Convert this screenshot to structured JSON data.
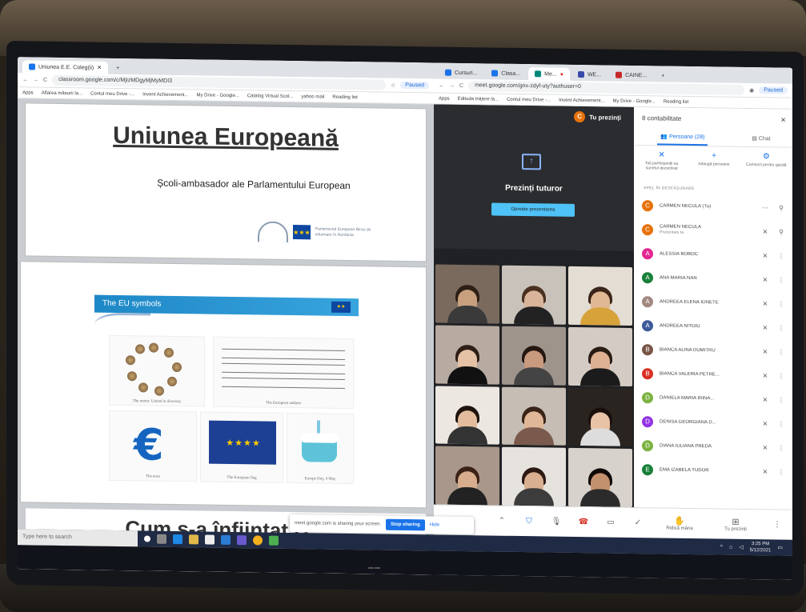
{
  "left_browser": {
    "tab_title": "Uniunea E.E. Coleg(ii)",
    "url": "classroom.google.com/c/MjIzMDgyMjMyMDI3",
    "profile": "Paused",
    "bookmarks": [
      "Apps",
      "Aflarea măsurii la...",
      "Contul meu Drive -...",
      "Invent Achievement...",
      "My Drive - Google...",
      "Catalog Virtual Scol...",
      "yahoo mail",
      "Reading list"
    ]
  },
  "slides": {
    "slide1_title": "Uniunea Europeană",
    "slide1_subtitle": "Școli-ambasador ale Parlamentului European",
    "ep_logo_text": "Parlamentul European Birou de informare în România",
    "slide2_banner": "The EU symbols",
    "captions": {
      "motto": "The motto: United in diversity",
      "anthem": "The European anthem",
      "euro": "The euro",
      "flag": "The European flag",
      "europe_day": "Europe Day, 9 May"
    },
    "slide3_title": "Cum s-a înființat U..."
  },
  "share_bar": {
    "message": "meet.google.com is sharing your screen.",
    "stop": "Stop sharing",
    "hide": "Hide"
  },
  "taskbar": {
    "search_placeholder": "Type here to search",
    "time": "3:25 PM",
    "date": "5/12/2021"
  },
  "right_browser": {
    "tabs": [
      "Cursuri...",
      "Clasa...",
      "Me...",
      "WE...",
      "CAINE..."
    ],
    "url": "meet.google.com/gnx-zdyf-uty?authuser=0",
    "profile": "Paused",
    "bookmarks": [
      "Apps",
      "Edituda Inițiere la...",
      "Contul meu Drive -...",
      "Invent Achievement...",
      "My Drive - Google...",
      "Reading list"
    ]
  },
  "meet": {
    "presenter_label": "Tu prezinți",
    "presenter_initial": "C",
    "presenting_to_all": "Prezinți tuturor",
    "stop_presenting": "Oprește prezentarea",
    "controls": {
      "contacts_label": "8 conta...",
      "raise_hand": "Ridică mâna",
      "you_present": "Tu prezinți"
    }
  },
  "people_panel": {
    "header": "8 contabilitate",
    "tab_people": "Persoane (28)",
    "tab_chat": "Chat",
    "actions": [
      "Toți participanții au sunetul dezactivat",
      "Adaugă persoane",
      "Comenzi pentru gazdă"
    ],
    "section_label": "APEL ÎN DESFĂȘURARE",
    "people": [
      {
        "initial": "C",
        "name": "CARMEN NECULA (Tu)",
        "sub": "",
        "color": "#e8710a"
      },
      {
        "initial": "C",
        "name": "CARMEN NECULA",
        "sub": "Prezentare ta",
        "color": "#e8710a"
      },
      {
        "initial": "A",
        "name": "ALESSIA BOBOC",
        "sub": "",
        "color": "#e52592"
      },
      {
        "initial": "A",
        "name": "ANA MARIA NAN",
        "sub": "",
        "color": "#188038"
      },
      {
        "initial": "A",
        "name": "ANDREEA ELENA IONETE",
        "sub": "",
        "color": "#a1887f"
      },
      {
        "initial": "A",
        "name": "ANDREEA NITOIU",
        "sub": "",
        "color": "#3c5a99"
      },
      {
        "initial": "B",
        "name": "BIANCA ALINA DUMITRU",
        "sub": "",
        "color": "#795548"
      },
      {
        "initial": "B",
        "name": "BIANCA VALERIA PETRE...",
        "sub": "",
        "color": "#d93025"
      },
      {
        "initial": "D",
        "name": "DANIELA MARIA IRINA...",
        "sub": "",
        "color": "#7cb342"
      },
      {
        "initial": "D",
        "name": "DENISA GEORGIANA D...",
        "sub": "",
        "color": "#9334e6"
      },
      {
        "initial": "D",
        "name": "DIANA IULIANA PREDA",
        "sub": "",
        "color": "#7cb342"
      },
      {
        "initial": "E",
        "name": "EMA IZABELA TUDOR",
        "sub": "",
        "color": "#188038"
      }
    ]
  },
  "colors": {
    "meet_blue": "#1a73e8",
    "meet_dark": "#202124",
    "eu_blue": "#1d3f94",
    "eu_gold": "#ffcc00"
  }
}
